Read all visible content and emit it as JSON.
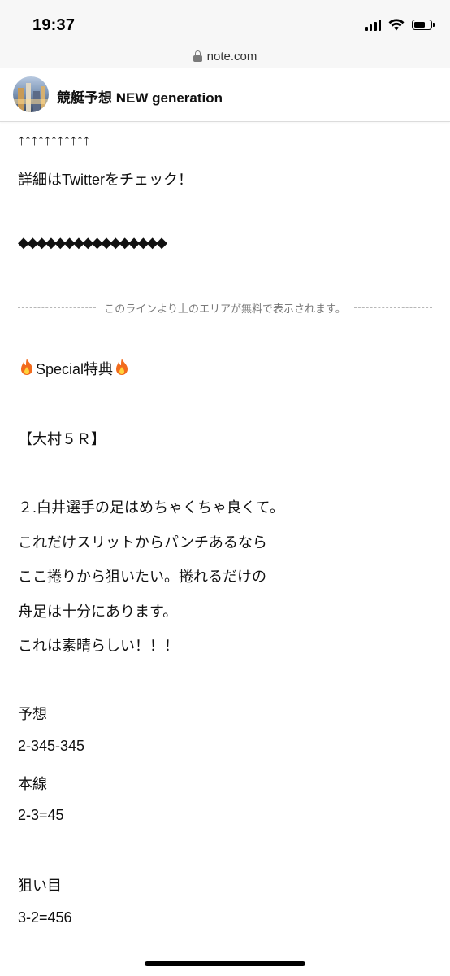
{
  "status_bar": {
    "time": "19:37"
  },
  "browser": {
    "url": "note.com"
  },
  "header": {
    "title": "競艇予想 NEW generation"
  },
  "article": {
    "arrows": "↑↑↑↑↑↑↑↑↑↑↑",
    "twitter_line": "詳細はTwitterをチェック！",
    "diamonds": "◆◆◆◆◆◆◆◆◆◆◆◆◆◆◆◆",
    "free_area_notice": "このラインより上のエリアが無料で表示されます。",
    "special_label": "Special特典",
    "race": "【大村５Ｒ】",
    "body_lines": [
      "２.白井選手の足はめちゃくちゃ良くて。",
      "これだけスリットからパンチあるなら",
      "ここ捲りから狙いたい。捲れるだけの",
      "舟足は十分にあります。",
      "これは素晴らしい！！！"
    ],
    "prediction_label": "予想",
    "prediction_value": "2-345-345",
    "main_label": "本線",
    "main_value": "2-3=45",
    "target_label": "狙い目",
    "target_value": "3-2=456"
  },
  "colors": {
    "text": "#111111",
    "muted": "#7a7a7a",
    "bar_background": "#f7f7f7",
    "fire": "#f26b1d"
  },
  "icons": [
    "signal-icon",
    "wifi-icon",
    "battery-icon",
    "lock-icon",
    "fire-icon"
  ]
}
